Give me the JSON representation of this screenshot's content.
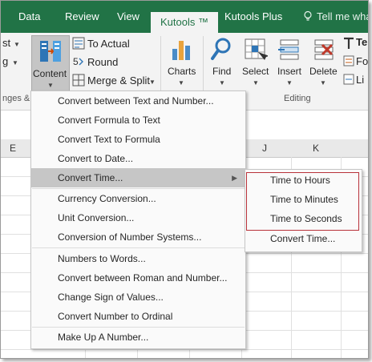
{
  "tabs": [
    {
      "label": "Data",
      "active": false
    },
    {
      "label": "Review",
      "active": false
    },
    {
      "label": "View",
      "active": false
    },
    {
      "label": "Kutools ™",
      "active": true
    },
    {
      "label": "Kutools Plus",
      "active": false
    }
  ],
  "tell_me": "Tell me wha",
  "ribbon": {
    "clipped_left": [
      "st",
      "g",
      "nges &"
    ],
    "content_label": "Content",
    "to_actual": "To Actual",
    "round": "Round",
    "merge_split": "Merge & Split",
    "charts": "Charts",
    "find": "Find",
    "select": "Select",
    "insert": "Insert",
    "delete": "Delete",
    "clipped_right": [
      "Te",
      "Fo",
      "Li"
    ],
    "editing_group": "Editing"
  },
  "columns": {
    "left": "E",
    "j": "J",
    "k": "K"
  },
  "menu": {
    "items": [
      "Convert between Text and Number...",
      "Convert Formula to Text",
      "Convert Text to Formula",
      "Convert to Date...",
      "Convert Time...",
      "Currency Conversion...",
      "Unit Conversion...",
      "Conversion of Number Systems...",
      "Numbers to Words...",
      "Convert between Roman and Number...",
      "Change Sign of Values...",
      "Convert Number to Ordinal",
      "Make Up A Number..."
    ],
    "highlighted": "Convert Time..."
  },
  "submenu": {
    "items": [
      "Time to Hours",
      "Time to Minutes",
      "Time to Seconds",
      "Convert Time..."
    ]
  },
  "colors": {
    "excel_green": "#217346",
    "highlight_box": "#b8323a"
  }
}
